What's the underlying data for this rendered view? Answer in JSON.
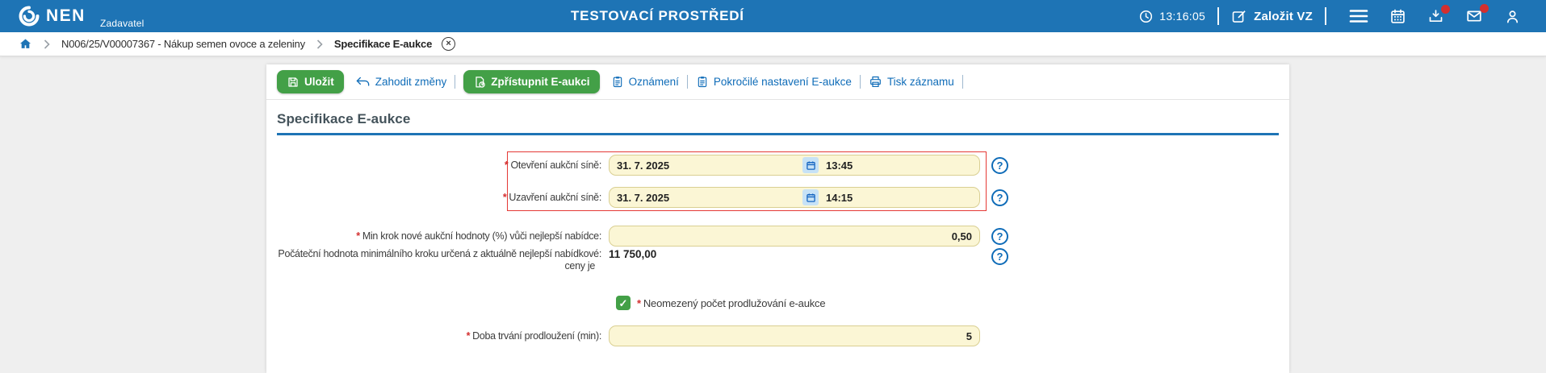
{
  "topbar": {
    "logo": "NEN",
    "logo_sub": "Zadavatel",
    "environment_title": "TESTOVACÍ PROSTŘEDÍ",
    "clock_time": "13:16:05",
    "create_vz": "Založit VZ"
  },
  "breadcrumb": {
    "items": [
      {
        "label": "N006/25/V00007367 - Nákup semen ovoce a zeleniny"
      },
      {
        "label": "Specifikace E-aukce"
      }
    ]
  },
  "toolbar": {
    "save": "Uložit",
    "discard": "Zahodit změny",
    "open_auction": "Zpřístupnit E-aukci",
    "notifications": "Oznámení",
    "advanced": "Pokročilé nastavení E-aukce",
    "print": "Tisk záznamu"
  },
  "section": {
    "title": "Specifikace E-aukce"
  },
  "form": {
    "asterisk": "*",
    "open_room": {
      "label": "Otevření aukční síně:",
      "date": "31. 7. 2025",
      "time": "13:45",
      "required": true
    },
    "close_room": {
      "label": "Uzavření aukční síně:",
      "date": "31. 7. 2025",
      "time": "14:15",
      "required": true
    },
    "min_step": {
      "label": "Min krok nové aukční hodnoty (%) vůči nejlepší nabídce:",
      "value": "0,50",
      "required": true
    },
    "initial_step": {
      "label_line1": "Počáteční hodnota minimálního kroku určená z aktuálně nejlepší nabídkové:",
      "label_line2": "ceny je",
      "value": "11 750,00"
    },
    "unlimited_extensions": {
      "label": "Neomezený počet prodlužování e-aukce",
      "checked": true,
      "required": true
    },
    "extension_duration": {
      "label": "Doba trvání prodloužení (min):",
      "value": "5",
      "required": true
    }
  },
  "icons": {
    "question": "?",
    "close": "×",
    "check": "✓"
  },
  "colors": {
    "topbar_blue": "#1E74B5",
    "accent_blue": "#0F6CB8",
    "button_green": "#43A047",
    "highlight_red": "#E53935",
    "input_yellow": "#FBF6D5",
    "badge_red": "#D32F2F"
  }
}
